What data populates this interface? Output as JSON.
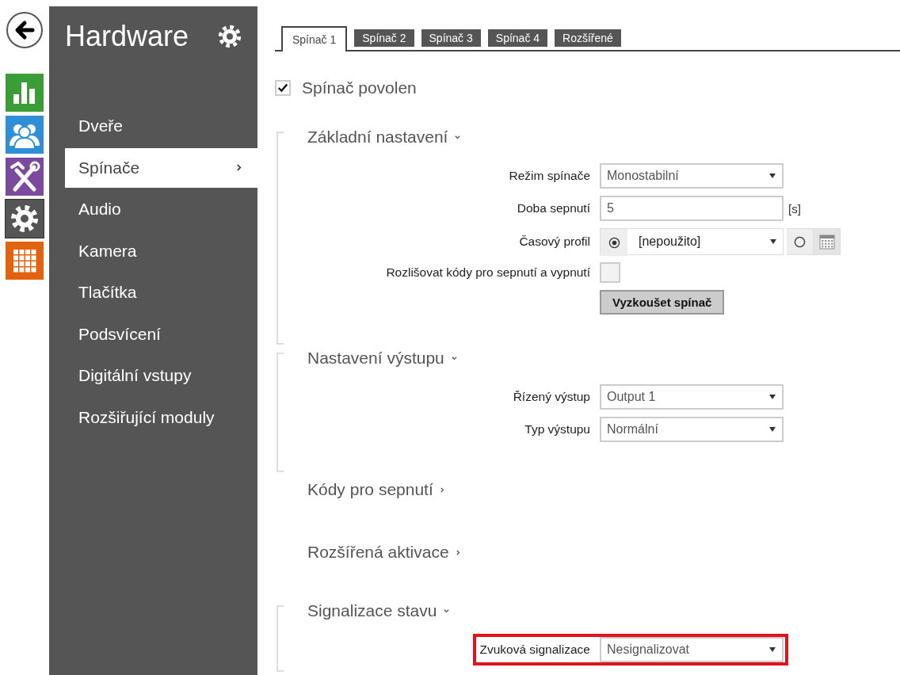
{
  "app_icons": [
    {
      "color": "#3a9d35",
      "selected": false
    },
    {
      "color": "#2e8fd6",
      "selected": false
    },
    {
      "color": "#7b4a9e",
      "selected": false
    },
    {
      "color": "#555555",
      "selected": true
    },
    {
      "color": "#e2620e",
      "selected": false
    }
  ],
  "sidebar": {
    "title": "Hardware",
    "items": [
      {
        "label": "Dveře",
        "selected": false
      },
      {
        "label": "Spínače",
        "selected": true
      },
      {
        "label": "Audio",
        "selected": false
      },
      {
        "label": "Kamera",
        "selected": false
      },
      {
        "label": "Tlačítka",
        "selected": false
      },
      {
        "label": "Podsvícení",
        "selected": false
      },
      {
        "label": "Digitální vstupy",
        "selected": false
      },
      {
        "label": "Rozšiřující moduly",
        "selected": false
      }
    ]
  },
  "tabs": [
    {
      "label": "Spínač 1",
      "selected": true
    },
    {
      "label": "Spínač 2",
      "selected": false
    },
    {
      "label": "Spínač 3",
      "selected": false
    },
    {
      "label": "Spínač 4",
      "selected": false
    },
    {
      "label": "Rozšířené",
      "selected": false
    }
  ],
  "enabled": {
    "label": "Spínač povolen",
    "checked": true
  },
  "sections": [
    {
      "title": "Základní nastavení",
      "expanded": true,
      "fields": [
        {
          "kind": "select",
          "label": "Režim spínače",
          "value": "Monostabilní",
          "highlighted": false
        },
        {
          "kind": "text",
          "label": "Doba sepnutí",
          "value": "5",
          "unit": "[s]",
          "highlighted": false
        },
        {
          "kind": "profile",
          "label": "Časový profil",
          "value": "[nepoužito]",
          "use_profile": true,
          "highlighted": false
        },
        {
          "kind": "checkbox",
          "label": "Rozlišovat kódy pro sepnutí a vypnutí",
          "checked": false,
          "highlighted": false
        },
        {
          "kind": "button",
          "label": "Vyzkoušet spínač",
          "highlighted": false
        }
      ]
    },
    {
      "title": "Nastavení výstupu",
      "expanded": true,
      "fields": [
        {
          "kind": "select",
          "label": "Řízený výstup",
          "value": "Output 1",
          "highlighted": false
        },
        {
          "kind": "select",
          "label": "Typ výstupu",
          "value": "Normální",
          "highlighted": false
        }
      ]
    },
    {
      "title": "Kódy pro sepnutí",
      "expanded": false
    },
    {
      "title": "Rozšířená aktivace",
      "expanded": false
    },
    {
      "title": "Signalizace stavu",
      "expanded": true,
      "fields": [
        {
          "kind": "select",
          "label": "Zvuková signalizace",
          "value": "Nesignalizovat",
          "highlighted": true
        }
      ]
    }
  ]
}
